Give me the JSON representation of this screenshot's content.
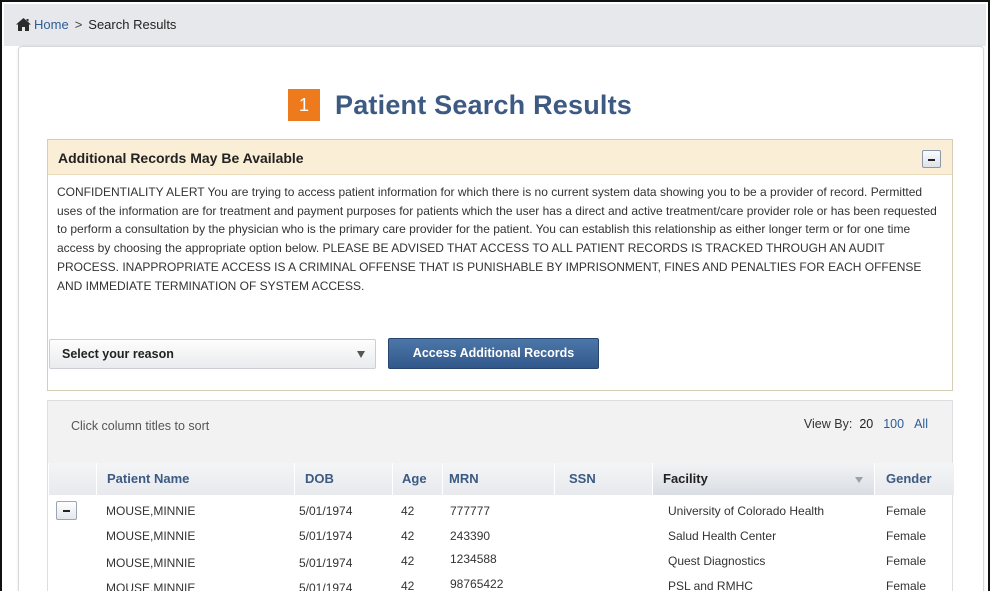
{
  "breadcrumb": {
    "home": "Home",
    "separator": ">",
    "current": "Search Results"
  },
  "badge": "1",
  "page_title": "Patient Search Results",
  "alert": {
    "title": "Additional Records May Be Available",
    "body": "CONFIDENTIALITY ALERT You are trying to access patient information for which there is no current system data showing you to be a provider of record. Permitted uses of the information are for treatment and payment purposes for patients which the user has a direct and active treatment/care provider role or has been requested to perform a consultation by the physician who is the primary care provider for the patient. You can establish this relationship as either longer term or for one time access by choosing the appropriate option below. PLEASE BE ADVISED THAT ACCESS TO ALL PATIENT RECORDS IS TRACKED THROUGH AN AUDIT PROCESS. INAPPROPRIATE ACCESS IS A CRIMINAL OFFENSE THAT IS PUNISHABLE BY IMPRISONMENT, FINES AND PENALTIES FOR EACH OFFENSE AND IMMEDIATE TERMINATION OF SYSTEM ACCESS.",
    "select_label": "Select your reason",
    "access_button": "Access Additional Records"
  },
  "results": {
    "sort_hint": "Click column titles to sort",
    "view_by_label": "View By:",
    "view_by_options": [
      "20",
      "100",
      "All"
    ],
    "columns": [
      "Patient Name",
      "DOB",
      "Age",
      "MRN",
      "SSN",
      "Facility",
      "Gender"
    ],
    "rows": [
      {
        "name": "MOUSE,MINNIE",
        "dob": "5/01/1974",
        "age": "42",
        "mrn": "777777",
        "ssn": "",
        "facility": "University of Colorado Health",
        "gender": "Female"
      },
      {
        "name": "MOUSE,MINNIE",
        "dob": "5/01/1974",
        "age": "42",
        "mrn": "243390",
        "ssn": "",
        "facility": "Salud Health Center",
        "gender": "Female"
      },
      {
        "name": "MOUSE,MINNIE",
        "dob": "5/01/1974",
        "age": "42",
        "mrn": "1234588",
        "ssn": "",
        "facility": "Quest Diagnostics",
        "gender": "Female"
      },
      {
        "name": "MOUSE,MINNIE",
        "dob": "5/01/1974",
        "age": "42",
        "mrn": "98765422",
        "ssn": "",
        "facility": "PSL and RMHC",
        "gender": "Female"
      }
    ]
  },
  "colors": {
    "title": "#3c5a82",
    "link": "#2d5c96",
    "badge": "#ee7a1e",
    "alert_header": "#fbeed6",
    "button": "#3a6194"
  }
}
